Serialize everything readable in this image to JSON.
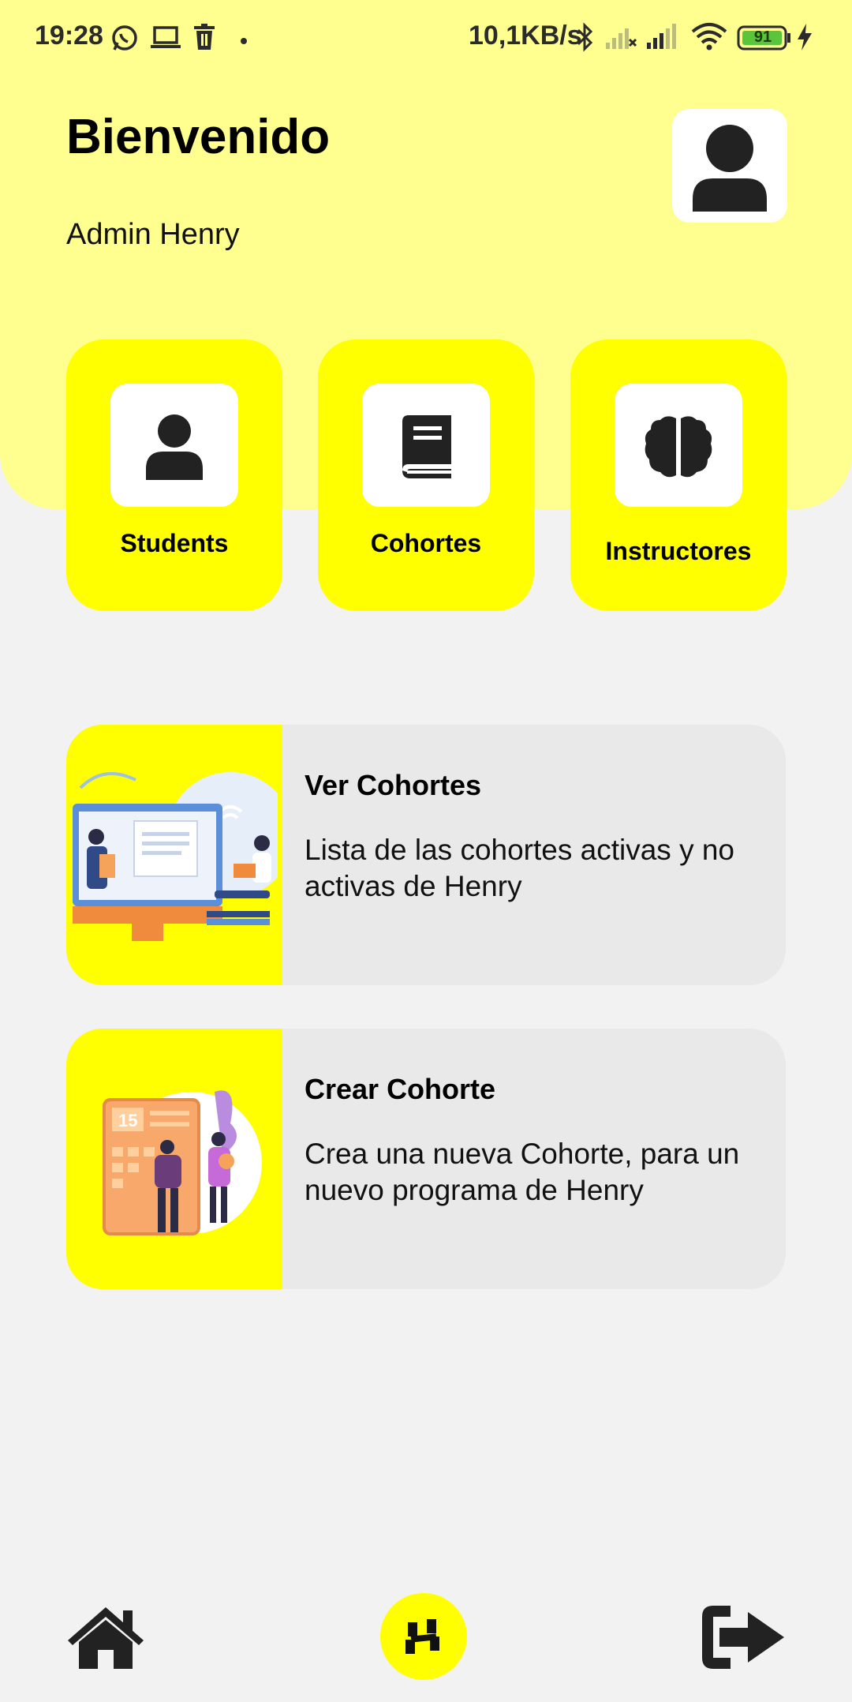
{
  "status_bar": {
    "time": "19:28",
    "network_speed": "10,1KB/s",
    "battery": "91",
    "icons": [
      "whatsapp-icon",
      "laptop-icon",
      "trash-icon",
      "dot-icon",
      "bluetooth-icon",
      "signal-x-icon",
      "signal-icon",
      "wifi-icon",
      "battery-icon",
      "charging-icon"
    ]
  },
  "header": {
    "title": "Bienvenido",
    "subtitle": "Admin Henry",
    "avatar_icon": "user-icon"
  },
  "quick_actions": [
    {
      "label": "Students",
      "icon": "user-icon"
    },
    {
      "label": "Cohortes",
      "icon": "book-icon"
    },
    {
      "label": "Instructores",
      "icon": "brain-icon"
    }
  ],
  "cards": [
    {
      "title": "Ver Cohortes",
      "description": "Lista de las cohortes activas y no activas de Henry",
      "illustration": "online-class-illustration"
    },
    {
      "title": "Crear Cohorte",
      "description": "Crea una nueva Cohorte, para un nuevo programa de Henry",
      "illustration": "calendar-meeting-illustration",
      "calendar_number": "15"
    }
  ],
  "bottom_nav": {
    "items": [
      "home-icon",
      "henry-logo-icon",
      "logout-icon"
    ]
  },
  "colors": {
    "header_bg": "#ffff8f",
    "accent": "#ffff00",
    "page_bg": "#f2f2f2",
    "card_bg": "#e9e9e9",
    "icon_dark": "#222222"
  }
}
